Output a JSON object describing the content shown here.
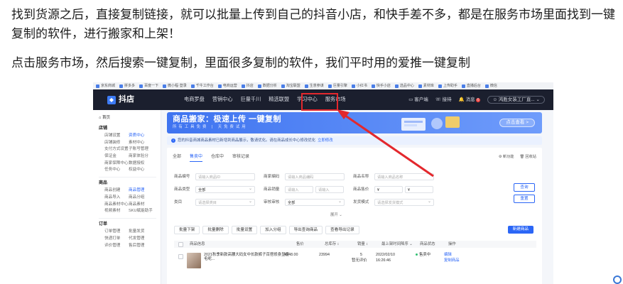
{
  "article": {
    "para1": "找到货源之后，直接复制链接，就可以批量上传到自己的抖音小店，和快手差不多，都是在服务市场里面找到一键复制的软件，进行搬家和上架！",
    "para2": "点击服务市场，然后搜索一键复制，里面很多复制的软件，我们平时用的爱推一键复制"
  },
  "screenshot": {
    "bookmarks": [
      "京东商城",
      "拼多多",
      "百度一下",
      "微小程·登录",
      "千牛工作台",
      "电商运营",
      "抖店",
      "数据分析",
      "淘宝联盟",
      "生意参谋",
      "巨量引擎",
      "小红书",
      "快手小店",
      "选品中心",
      "素材库",
      "上传助手",
      "直播后台",
      "微信"
    ],
    "app_name": "抖店",
    "nav": [
      "电商罗盘",
      "营销中心",
      "巨量千川",
      "精选联盟",
      "学习中心",
      "服务市场"
    ],
    "nav_right": {
      "client": "客户端",
      "grab": "接待",
      "message": "消息",
      "message_badge": "6",
      "shop": "鸿胜女装工厂直..."
    },
    "sidebar": {
      "home": "首页",
      "groups": [
        {
          "title": "店铺",
          "items": [
            "店铺设置",
            "资质中心",
            "店铺装修",
            "素材中心",
            "支付方式设置",
            "子账号管理",
            "保证金",
            "商家体验分",
            "商家保障中心",
            "数据授权",
            "任务中心",
            "权益中心"
          ],
          "active_index": 1
        },
        {
          "title": "商品",
          "items": [
            "商品创建",
            "商品管理",
            "商品导入",
            "商品分组",
            "商品素材中心",
            "商品素材",
            "视频素材",
            "SKU赋能助手"
          ],
          "active_index": 1
        },
        {
          "title": "订单",
          "items": [
            "订单管理",
            "批量发货",
            "快递打单",
            "代发管理",
            "评价管理",
            "售后管理"
          ],
          "active_index": -1
        }
      ]
    },
    "banner": {
      "title": "商品搬家：极速上传  一键复制",
      "subtitle": "所有工具免费 | 天免费试用",
      "button": "点击查看 >"
    },
    "notice": {
      "text": "您的抖音商城商品素材已新增到商品展示，敬请优化。请在商品成长中心修改优化",
      "link": "立即修改"
    },
    "tabs": [
      "全部",
      "售卖中",
      "仓库中",
      "审核记录"
    ],
    "active_tab": 1,
    "tab_tools": [
      "新功能",
      "回收站"
    ],
    "filters": {
      "row1": [
        {
          "label": "商品编号",
          "placeholder": "请输入商品ID"
        },
        {
          "label": "商家编码",
          "placeholder": "请输入商品编码"
        },
        {
          "label": "商品名称",
          "placeholder": "请输入商品名称"
        }
      ],
      "row2": [
        {
          "label": "商品类型",
          "value": "全部"
        },
        {
          "label": "商品销量",
          "from": "请输入",
          "to": "请输入"
        },
        {
          "label": "商品售价",
          "from": "¥",
          "to": "¥"
        }
      ],
      "row3": [
        {
          "label": "类目",
          "placeholder": "请选择类目"
        },
        {
          "label": "审核审核",
          "value": "全部"
        },
        {
          "label": "发货模式",
          "placeholder": "请选择发货模式"
        }
      ],
      "search_btn": "查询",
      "reset_btn": "重置",
      "expand": "展开 ⌄"
    },
    "actions": [
      "批量下架",
      "批量删除",
      "批量设置",
      "加入分组",
      "导出查询商品",
      "查看导出记录"
    ],
    "new_btn": "新建商品",
    "table": {
      "headers": [
        "商品信息",
        "售价",
        "总库存 ↕",
        "销量 ↕",
        "最上架时间降序 ⌄",
        "商品状态",
        "操作"
      ],
      "row": {
        "title": "2021秋季新款高腰大码女中长款裤子百搭修身显瘦毛呢...",
        "price": "¥248.00",
        "stock": "23994",
        "sales": "5",
        "sales_sub": "暂无评价",
        "date": "2022/02/10",
        "time": "16:26:46",
        "status": "售卖中",
        "op1": "编辑",
        "op2": "复制商品"
      }
    }
  },
  "colors": {
    "highlight": "#e3282d",
    "accent": "#2b66f6",
    "nav_bg": "#1b1f2e"
  }
}
